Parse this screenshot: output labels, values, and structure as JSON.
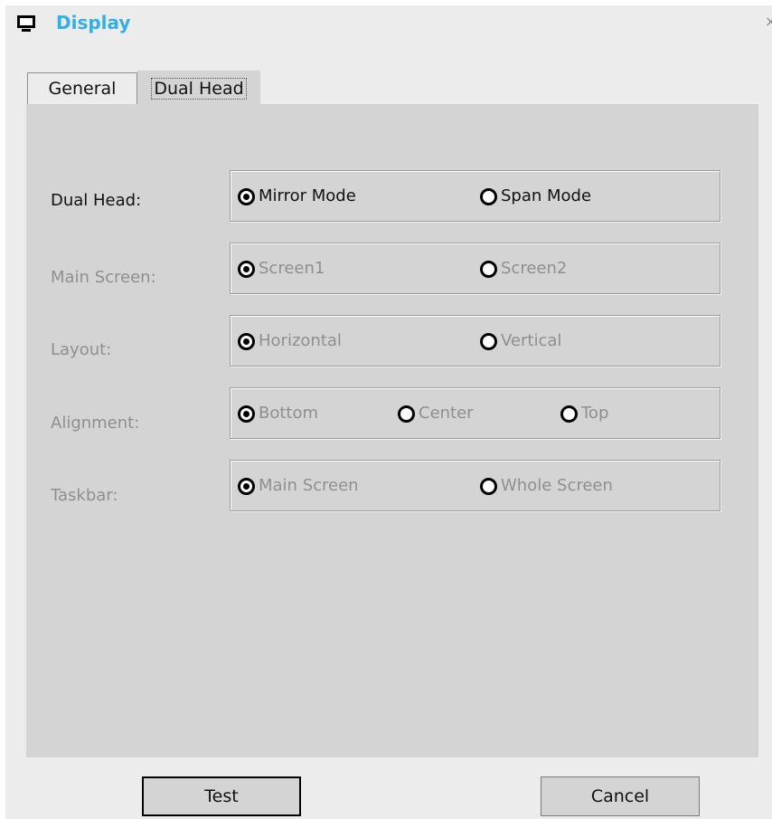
{
  "window": {
    "title": "Display",
    "close_glyph": "×"
  },
  "tabs": [
    {
      "label": "General",
      "active": false
    },
    {
      "label": "Dual Head",
      "active": true
    }
  ],
  "rows": [
    {
      "label": "Dual Head:",
      "enabled": true,
      "options": [
        {
          "label": "Mirror Mode",
          "checked": true
        },
        {
          "label": "Span Mode",
          "checked": false
        }
      ]
    },
    {
      "label": "Main Screen:",
      "enabled": false,
      "options": [
        {
          "label": "Screen1",
          "checked": true
        },
        {
          "label": "Screen2",
          "checked": false
        }
      ]
    },
    {
      "label": "Layout:",
      "enabled": false,
      "options": [
        {
          "label": "Horizontal",
          "checked": true
        },
        {
          "label": "Vertical",
          "checked": false
        }
      ]
    },
    {
      "label": "Alignment:",
      "enabled": false,
      "options": [
        {
          "label": "Bottom",
          "checked": true
        },
        {
          "label": "Center",
          "checked": false
        },
        {
          "label": "Top",
          "checked": false
        }
      ]
    },
    {
      "label": "Taskbar:",
      "enabled": false,
      "options": [
        {
          "label": "Main Screen",
          "checked": true
        },
        {
          "label": "Whole Screen",
          "checked": false
        }
      ]
    }
  ],
  "buttons": {
    "test": "Test",
    "cancel": "Cancel"
  },
  "colors": {
    "title": "#33aee6",
    "disabled_text": "#8f8f8f",
    "panel": "#d4d4d4"
  },
  "icons": {
    "app": "monitor-icon",
    "close": "close-icon",
    "radio": "radio-button-icon"
  }
}
